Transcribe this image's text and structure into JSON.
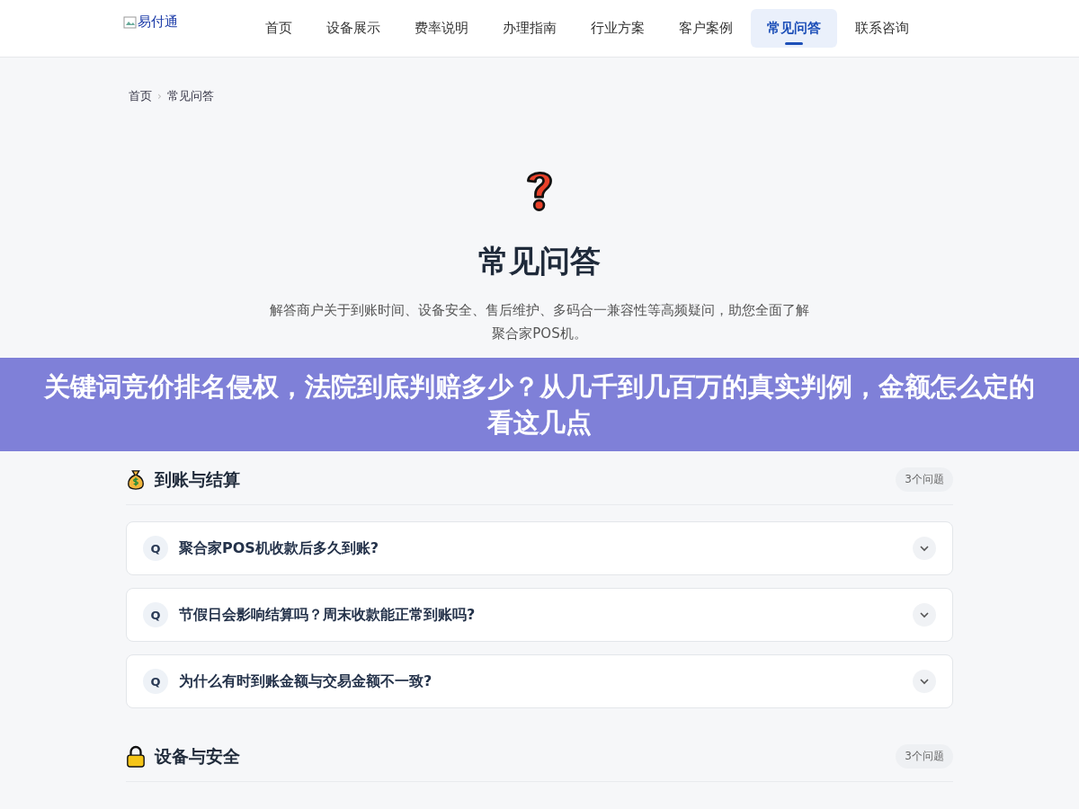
{
  "header": {
    "logo_alt": "易付通",
    "nav": [
      {
        "label": "首页",
        "selected": false
      },
      {
        "label": "设备展示",
        "selected": false
      },
      {
        "label": "费率说明",
        "selected": false
      },
      {
        "label": "办理指南",
        "selected": false
      },
      {
        "label": "行业方案",
        "selected": false
      },
      {
        "label": "客户案例",
        "selected": false
      },
      {
        "label": "常见问答",
        "selected": true
      },
      {
        "label": "联系咨询",
        "selected": false
      }
    ]
  },
  "breadcrumb": {
    "separator": "›",
    "items": [
      "首页",
      "常见问答"
    ]
  },
  "hero": {
    "title": "常见问答",
    "description": "解答商户关于到账时间、设备安全、售后维护、多码合一兼容性等高频疑问，助您全面了解聚合家POS机。"
  },
  "banner": {
    "text": "关键词竞价排名侵权，法院到底判赔多少？从几千到几百万的真实判例，金额怎么定的看这几点"
  },
  "sections": [
    {
      "title": "到账与结算",
      "kind": "moneybag",
      "count": "3个问题",
      "questions": [
        {
          "badge": "Q",
          "text": "聚合家POS机收款后多久到账?",
          "expanded": false
        },
        {
          "badge": "Q",
          "text": "节假日会影响结算吗？周末收款能正常到账吗?",
          "expanded": false
        },
        {
          "badge": "Q",
          "text": "为什么有时到账金额与交易金额不一致?",
          "expanded": false
        }
      ]
    },
    {
      "title": "设备与安全",
      "kind": "lock",
      "count": "3个问题"
    }
  ]
}
